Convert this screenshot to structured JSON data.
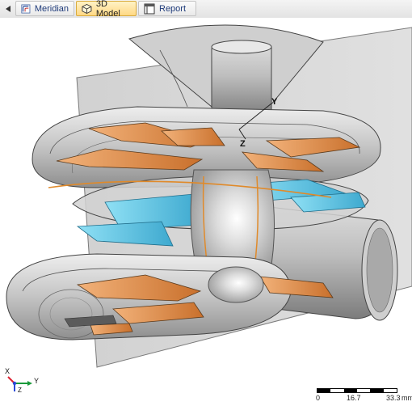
{
  "toolbar": {
    "back_icon": "triangle-left-icon",
    "tabs": [
      {
        "label": "Meridian",
        "icon": "meridian-icon",
        "active": false
      },
      {
        "label": "3D Model",
        "icon": "cube-icon",
        "active": true
      },
      {
        "label": "Report",
        "icon": "report-window-icon",
        "active": false
      }
    ]
  },
  "viewport": {
    "model_axes": {
      "y": "Y",
      "z": "Z"
    },
    "triad": {
      "x": "X",
      "y": "Y",
      "z": "Z"
    },
    "scale_bar": {
      "ticks": [
        "0",
        "16.7",
        "33.3"
      ],
      "unit": "mm"
    }
  },
  "colors": {
    "impeller_blade": "#e08a3c",
    "diffuser_blade": "#5bc0e0",
    "casing": "#b9b9b9",
    "meridian_plane": "#c8c8c8",
    "tab_active": "#ffd884"
  }
}
